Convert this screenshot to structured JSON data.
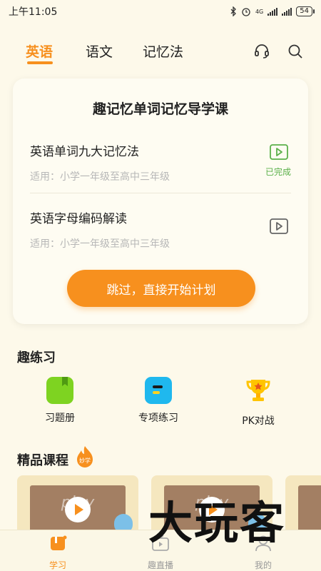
{
  "status_bar": {
    "time": "上午11:05",
    "network": "4G",
    "battery": "54"
  },
  "top_nav": {
    "tabs": [
      {
        "label": "英语",
        "active": true
      },
      {
        "label": "语文",
        "active": false
      },
      {
        "label": "记忆法",
        "active": false
      }
    ],
    "icons": [
      "headset-icon",
      "search-icon"
    ]
  },
  "guide_card": {
    "title": "趣记忆单词记忆导学课",
    "lessons": [
      {
        "title": "英语单词九大记忆法",
        "subtitle": "适用：小学一年级至高中三年级",
        "status": "已完成",
        "icon": "play-icon"
      },
      {
        "title": "英语字母编码解读",
        "subtitle": "适用：小学一年级至高中三年级",
        "status": "",
        "icon": "play-icon"
      }
    ],
    "skip_button": "跳过，直接开始计划"
  },
  "practice": {
    "title": "趣练习",
    "items": [
      {
        "label": "习题册",
        "icon": "exercise-book-icon",
        "color": "#7ed321"
      },
      {
        "label": "专项练习",
        "icon": "special-practice-icon",
        "color": "#1fb8ee"
      },
      {
        "label": "PK对战",
        "icon": "trophy-icon",
        "color": "#ffc400"
      }
    ]
  },
  "courses": {
    "title": "精品课程",
    "badge": "妙学",
    "cards": [
      {
        "play_text": "play"
      },
      {
        "play_text": "play"
      },
      {
        "play_text": ""
      }
    ]
  },
  "bottom_nav": {
    "items": [
      {
        "label": "学习",
        "icon": "study-icon",
        "active": true
      },
      {
        "label": "趣直播",
        "icon": "live-tv-icon",
        "active": false
      },
      {
        "label": "我的",
        "icon": "profile-icon",
        "active": false
      }
    ]
  },
  "watermark": "大玩客",
  "colors": {
    "accent": "#f7901e",
    "done": "#5bb04a",
    "background": "#fdf9ea"
  }
}
